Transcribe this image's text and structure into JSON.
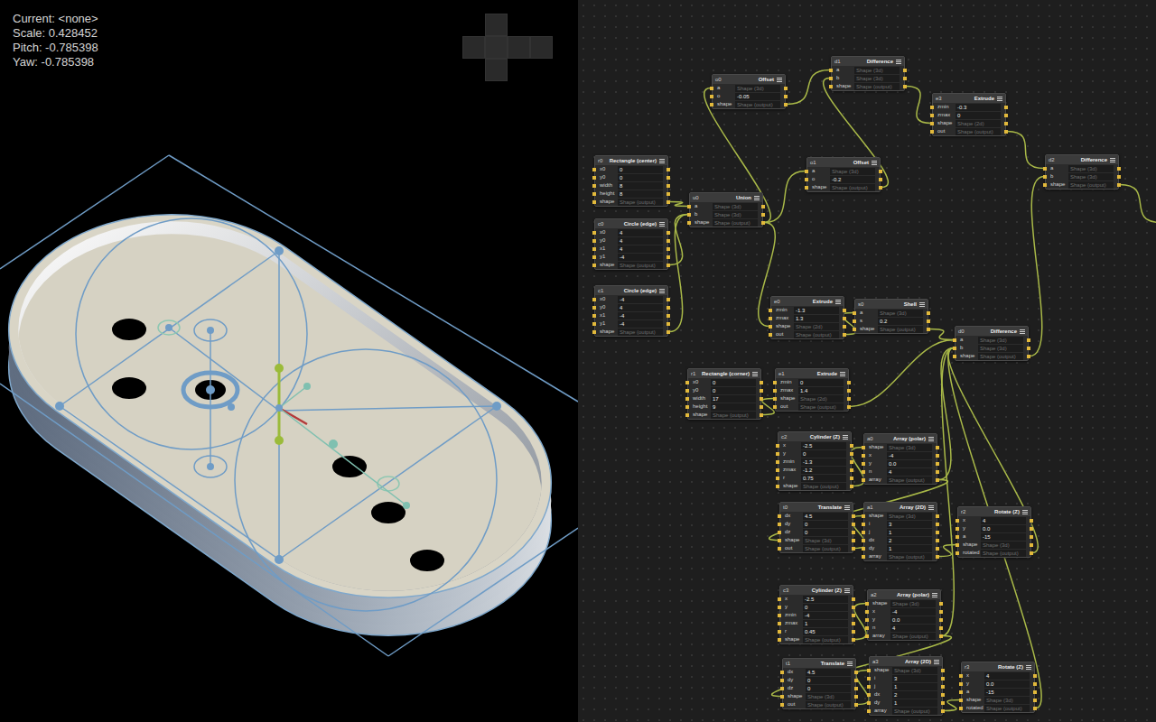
{
  "viewport": {
    "info": [
      "Current: <none>",
      "Scale: 0.428452",
      "Pitch: -0.785398",
      "Yaw: -0.785398"
    ]
  },
  "graph": {
    "nodes": [
      {
        "id": "o0",
        "type": "Offset",
        "rows": [
          {
            "label": "a",
            "value": "Shape (3d)",
            "kind": "link"
          },
          {
            "label": "o",
            "value": "-0.05",
            "kind": "value"
          },
          {
            "label": "shape",
            "value": "Shape (output)",
            "kind": "link"
          }
        ]
      },
      {
        "id": "d1",
        "type": "Difference",
        "rows": [
          {
            "label": "a",
            "value": "Shape (3d)",
            "kind": "link"
          },
          {
            "label": "b",
            "value": "Shape (3d)",
            "kind": "link"
          },
          {
            "label": "shape",
            "value": "Shape (output)",
            "kind": "link"
          }
        ]
      },
      {
        "id": "e3",
        "type": "Extrude",
        "rows": [
          {
            "label": "zmin",
            "value": "-0.3",
            "kind": "value"
          },
          {
            "label": "zmax",
            "value": "0",
            "kind": "value"
          },
          {
            "label": "shape",
            "value": "Shape (2d)",
            "kind": "link"
          },
          {
            "label": "out",
            "value": "Shape (output)",
            "kind": "link"
          }
        ]
      },
      {
        "id": "o1",
        "type": "Offset",
        "rows": [
          {
            "label": "a",
            "value": "Shape (3d)",
            "kind": "link"
          },
          {
            "label": "o",
            "value": "-0.2",
            "kind": "value"
          },
          {
            "label": "shape",
            "value": "Shape (output)",
            "kind": "link"
          }
        ]
      },
      {
        "id": "u0",
        "type": "Union",
        "rows": [
          {
            "label": "a",
            "value": "Shape (3d)",
            "kind": "link"
          },
          {
            "label": "b",
            "value": "Shape (3d)",
            "kind": "link"
          },
          {
            "label": "shape",
            "value": "Shape (output)",
            "kind": "link"
          }
        ]
      },
      {
        "id": "r0",
        "type": "Rectangle (center)",
        "rows": [
          {
            "label": "x0",
            "value": "0",
            "kind": "value"
          },
          {
            "label": "y0",
            "value": "0",
            "kind": "value"
          },
          {
            "label": "width",
            "value": "8",
            "kind": "value"
          },
          {
            "label": "height",
            "value": "8",
            "kind": "value"
          },
          {
            "label": "shape",
            "value": "Shape (output)",
            "kind": "link"
          }
        ]
      },
      {
        "id": "c0",
        "type": "Circle (edge)",
        "rows": [
          {
            "label": "x0",
            "value": "4",
            "kind": "value"
          },
          {
            "label": "y0",
            "value": "4",
            "kind": "value"
          },
          {
            "label": "x1",
            "value": "4",
            "kind": "value"
          },
          {
            "label": "y1",
            "value": "-4",
            "kind": "value"
          },
          {
            "label": "shape",
            "value": "Shape (output)",
            "kind": "link"
          }
        ]
      },
      {
        "id": "c1",
        "type": "Circle (edge)",
        "rows": [
          {
            "label": "x0",
            "value": "-4",
            "kind": "value"
          },
          {
            "label": "y0",
            "value": "4",
            "kind": "value"
          },
          {
            "label": "x1",
            "value": "-4",
            "kind": "value"
          },
          {
            "label": "y1",
            "value": "-4",
            "kind": "value"
          },
          {
            "label": "shape",
            "value": "Shape (output)",
            "kind": "link"
          }
        ]
      },
      {
        "id": "e0",
        "type": "Extrude",
        "rows": [
          {
            "label": "zmin",
            "value": "-1.3",
            "kind": "value"
          },
          {
            "label": "zmax",
            "value": "1.3",
            "kind": "value"
          },
          {
            "label": "shape",
            "value": "Shape (2d)",
            "kind": "link"
          },
          {
            "label": "out",
            "value": "Shape (output)",
            "kind": "link"
          }
        ]
      },
      {
        "id": "s0",
        "type": "Shell",
        "rows": [
          {
            "label": "a",
            "value": "Shape (3d)",
            "kind": "link"
          },
          {
            "label": "s",
            "value": "0.2",
            "kind": "value"
          },
          {
            "label": "shape",
            "value": "Shape (output)",
            "kind": "link"
          }
        ]
      },
      {
        "id": "d0",
        "type": "Difference",
        "rows": [
          {
            "label": "a",
            "value": "Shape (3d)",
            "kind": "link"
          },
          {
            "label": "b",
            "value": "Shape (3d)",
            "kind": "link"
          },
          {
            "label": "shape",
            "value": "Shape (output)",
            "kind": "link"
          }
        ]
      },
      {
        "id": "d2",
        "type": "Difference",
        "rows": [
          {
            "label": "a",
            "value": "Shape (3d)",
            "kind": "link"
          },
          {
            "label": "b",
            "value": "Shape (3d)",
            "kind": "link"
          },
          {
            "label": "shape",
            "value": "Shape (output)",
            "kind": "link"
          }
        ]
      },
      {
        "id": "r1",
        "type": "Rectangle (corner)",
        "rows": [
          {
            "label": "x0",
            "value": "0",
            "kind": "value"
          },
          {
            "label": "y0",
            "value": "0",
            "kind": "value"
          },
          {
            "label": "width",
            "value": "17",
            "kind": "value"
          },
          {
            "label": "height",
            "value": "9",
            "kind": "value"
          },
          {
            "label": "shape",
            "value": "Shape (output)",
            "kind": "link"
          }
        ]
      },
      {
        "id": "e1",
        "type": "Extrude",
        "rows": [
          {
            "label": "zmin",
            "value": "0",
            "kind": "value"
          },
          {
            "label": "zmax",
            "value": "1.4",
            "kind": "value"
          },
          {
            "label": "shape",
            "value": "Shape (2d)",
            "kind": "link"
          },
          {
            "label": "out",
            "value": "Shape (output)",
            "kind": "link"
          }
        ]
      },
      {
        "id": "c2",
        "type": "Cylinder (Z)",
        "rows": [
          {
            "label": "x",
            "value": "-2.5",
            "kind": "value"
          },
          {
            "label": "y",
            "value": "0",
            "kind": "value"
          },
          {
            "label": "zmin",
            "value": "-1.3",
            "kind": "value"
          },
          {
            "label": "zmax",
            "value": "-1.2",
            "kind": "value"
          },
          {
            "label": "r",
            "value": "0.75",
            "kind": "value"
          },
          {
            "label": "shape",
            "value": "Shape (output)",
            "kind": "link"
          }
        ]
      },
      {
        "id": "a0",
        "type": "Array (polar)",
        "rows": [
          {
            "label": "shape",
            "value": "Shape (3d)",
            "kind": "link"
          },
          {
            "label": "x",
            "value": "-4",
            "kind": "value"
          },
          {
            "label": "y",
            "value": "0.0",
            "kind": "value"
          },
          {
            "label": "n",
            "value": "4",
            "kind": "value"
          },
          {
            "label": "array",
            "value": "Shape (output)",
            "kind": "link"
          }
        ]
      },
      {
        "id": "t0",
        "type": "Translate",
        "rows": [
          {
            "label": "dx",
            "value": "4.5",
            "kind": "value"
          },
          {
            "label": "dy",
            "value": "0",
            "kind": "value"
          },
          {
            "label": "dz",
            "value": "0",
            "kind": "value"
          },
          {
            "label": "shape",
            "value": "Shape (3d)",
            "kind": "link"
          },
          {
            "label": "out",
            "value": "Shape (output)",
            "kind": "link"
          }
        ]
      },
      {
        "id": "a1",
        "type": "Array (2D)",
        "rows": [
          {
            "label": "shape",
            "value": "Shape (3d)",
            "kind": "link"
          },
          {
            "label": "i",
            "value": "3",
            "kind": "value"
          },
          {
            "label": "j",
            "value": "1",
            "kind": "value"
          },
          {
            "label": "dx",
            "value": "2",
            "kind": "value"
          },
          {
            "label": "dy",
            "value": "1",
            "kind": "value"
          },
          {
            "label": "array",
            "value": "Shape (output)",
            "kind": "link"
          }
        ]
      },
      {
        "id": "r2",
        "type": "Rotate (Z)",
        "rows": [
          {
            "label": "x",
            "value": "4",
            "kind": "value"
          },
          {
            "label": "y",
            "value": "0.0",
            "kind": "value"
          },
          {
            "label": "a",
            "value": "-15",
            "kind": "value"
          },
          {
            "label": "shape",
            "value": "Shape (3d)",
            "kind": "link"
          },
          {
            "label": "rotated",
            "value": "Shape (output)",
            "kind": "link"
          }
        ]
      },
      {
        "id": "c3",
        "type": "Cylinder (Z)",
        "rows": [
          {
            "label": "x",
            "value": "-2.5",
            "kind": "value"
          },
          {
            "label": "y",
            "value": "0",
            "kind": "value"
          },
          {
            "label": "zmin",
            "value": "-4",
            "kind": "value"
          },
          {
            "label": "zmax",
            "value": "1",
            "kind": "value"
          },
          {
            "label": "r",
            "value": "0.45",
            "kind": "value"
          },
          {
            "label": "shape",
            "value": "Shape (output)",
            "kind": "link"
          }
        ]
      },
      {
        "id": "a2",
        "type": "Array (polar)",
        "rows": [
          {
            "label": "shape",
            "value": "Shape (3d)",
            "kind": "link"
          },
          {
            "label": "x",
            "value": "-4",
            "kind": "value"
          },
          {
            "label": "y",
            "value": "0.0",
            "kind": "value"
          },
          {
            "label": "n",
            "value": "4",
            "kind": "value"
          },
          {
            "label": "array",
            "value": "Shape (output)",
            "kind": "link"
          }
        ]
      },
      {
        "id": "t1",
        "type": "Translate",
        "rows": [
          {
            "label": "dx",
            "value": "4.5",
            "kind": "value"
          },
          {
            "label": "dy",
            "value": "0",
            "kind": "value"
          },
          {
            "label": "dz",
            "value": "0",
            "kind": "value"
          },
          {
            "label": "shape",
            "value": "Shape (3d)",
            "kind": "link"
          },
          {
            "label": "out",
            "value": "Shape (output)",
            "kind": "link"
          }
        ]
      },
      {
        "id": "a3",
        "type": "Array (2D)",
        "rows": [
          {
            "label": "shape",
            "value": "Shape (3d)",
            "kind": "link"
          },
          {
            "label": "i",
            "value": "3",
            "kind": "value"
          },
          {
            "label": "j",
            "value": "1",
            "kind": "value"
          },
          {
            "label": "dx",
            "value": "2",
            "kind": "value"
          },
          {
            "label": "dy",
            "value": "1",
            "kind": "value"
          },
          {
            "label": "array",
            "value": "Shape (output)",
            "kind": "link"
          }
        ]
      },
      {
        "id": "r3",
        "type": "Rotate (Z)",
        "rows": [
          {
            "label": "x",
            "value": "4",
            "kind": "value"
          },
          {
            "label": "y",
            "value": "0.0",
            "kind": "value"
          },
          {
            "label": "a",
            "value": "-15",
            "kind": "value"
          },
          {
            "label": "shape",
            "value": "Shape (3d)",
            "kind": "link"
          },
          {
            "label": "rotated",
            "value": "Shape (output)",
            "kind": "link"
          }
        ]
      }
    ],
    "edges": [
      {
        "from": [
          5,
          4
        ],
        "to": [
          4,
          0
        ]
      },
      {
        "from": [
          6,
          4
        ],
        "to": [
          4,
          1
        ]
      },
      {
        "from": [
          7,
          4
        ],
        "to": [
          4,
          1
        ]
      },
      {
        "from": [
          4,
          2
        ],
        "to": [
          0,
          0
        ]
      },
      {
        "from": [
          4,
          2
        ],
        "to": [
          3,
          0
        ]
      },
      {
        "from": [
          4,
          2
        ],
        "to": [
          8,
          2
        ]
      },
      {
        "from": [
          0,
          2
        ],
        "to": [
          1,
          0
        ]
      },
      {
        "from": [
          3,
          2
        ],
        "to": [
          1,
          1
        ]
      },
      {
        "from": [
          1,
          2
        ],
        "to": [
          2,
          2
        ]
      },
      {
        "from": [
          2,
          3
        ],
        "to": [
          11,
          0
        ]
      },
      {
        "from": [
          10,
          2
        ],
        "to": [
          11,
          1
        ]
      },
      {
        "from": [
          8,
          3
        ],
        "to": [
          9,
          0
        ]
      },
      {
        "from": [
          9,
          2
        ],
        "to": [
          10,
          0
        ]
      },
      {
        "from": [
          12,
          4
        ],
        "to": [
          13,
          2
        ]
      },
      {
        "from": [
          13,
          3
        ],
        "to": [
          10,
          0
        ]
      },
      {
        "from": [
          14,
          5
        ],
        "to": [
          15,
          0
        ]
      },
      {
        "from": [
          15,
          4
        ],
        "to": [
          16,
          3
        ]
      },
      {
        "from": [
          16,
          4
        ],
        "to": [
          17,
          0
        ]
      },
      {
        "from": [
          17,
          5
        ],
        "to": [
          18,
          3
        ]
      },
      {
        "from": [
          18,
          4
        ],
        "to": [
          10,
          1
        ]
      },
      {
        "from": [
          15,
          4
        ],
        "to": [
          10,
          1
        ]
      },
      {
        "from": [
          19,
          5
        ],
        "to": [
          20,
          0
        ]
      },
      {
        "from": [
          20,
          4
        ],
        "to": [
          21,
          3
        ]
      },
      {
        "from": [
          21,
          4
        ],
        "to": [
          22,
          0
        ]
      },
      {
        "from": [
          22,
          5
        ],
        "to": [
          23,
          3
        ]
      },
      {
        "from": [
          23,
          4
        ],
        "to": [
          10,
          1
        ]
      },
      {
        "from": [
          20,
          4
        ],
        "to": [
          10,
          1
        ]
      },
      {
        "from": [
          11,
          2
        ],
        "to": null
      }
    ]
  }
}
